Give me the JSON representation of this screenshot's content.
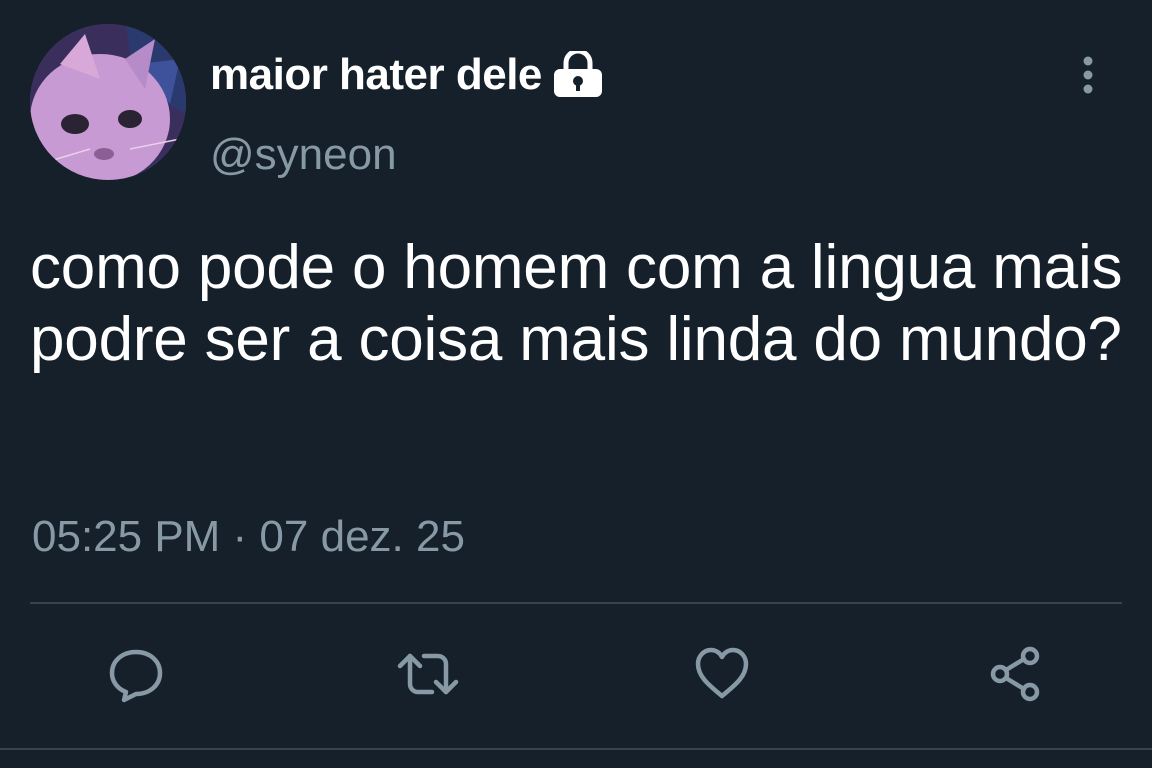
{
  "user": {
    "display_name": "maior hater dele",
    "handle": "@syneon",
    "protected_icon": "lock-icon",
    "avatar": "cat-photo-avatar"
  },
  "tweet": {
    "text": "como pode o homem com a lingua mais podre ser a coisa mais linda do mundo?",
    "timestamp": "05:25 PM · 07 dez. 25"
  },
  "actions": [
    {
      "name": "reply",
      "icon": "reply-icon"
    },
    {
      "name": "retweet",
      "icon": "retweet-icon"
    },
    {
      "name": "like",
      "icon": "heart-icon"
    },
    {
      "name": "share",
      "icon": "share-icon"
    }
  ],
  "colors": {
    "background": "#15202b",
    "primary_text": "#ffffff",
    "secondary_text": "#8899a6",
    "divider": "#38444d"
  }
}
